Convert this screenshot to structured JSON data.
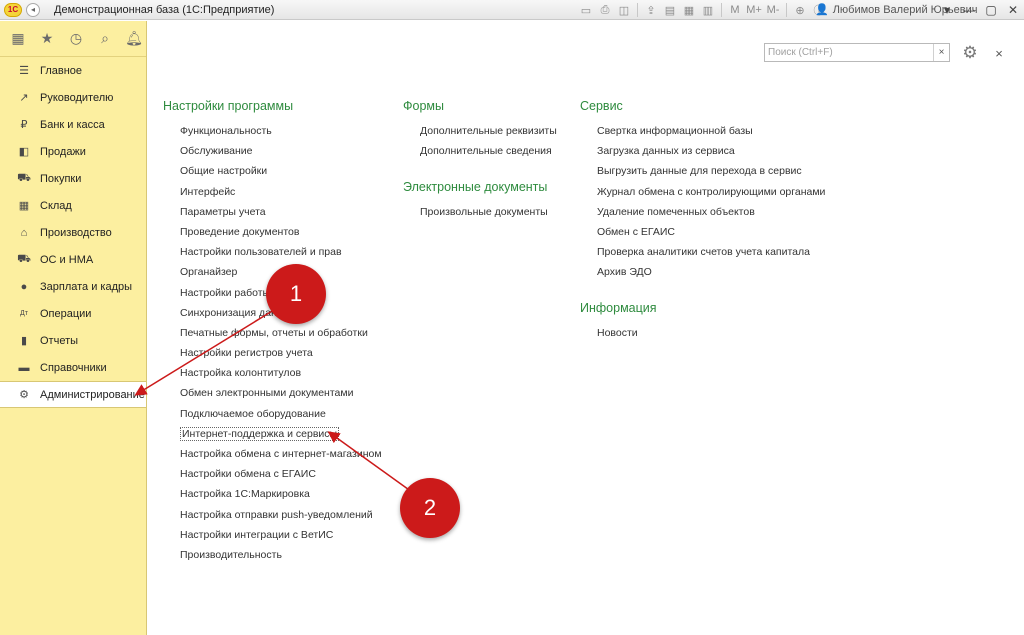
{
  "window": {
    "logo_text": "1С",
    "title": "Демонстрационная база  (1С:Предприятие)",
    "user": "Любимов Валерий Юрьевич",
    "toolbar_icons": [
      "save-icon",
      "print-icon",
      "preview-icon",
      "upload-icon",
      "doc-icon",
      "calc-icon",
      "calendar-icon",
      "M",
      "M+",
      "M-",
      "zoom-icon",
      "info-icon"
    ],
    "memory_labels": {
      "m": "M",
      "m_plus": "M+",
      "m_minus": "M-"
    }
  },
  "navbar": {
    "icons": [
      "apps-grid-icon",
      "star-icon",
      "history-icon",
      "search-icon",
      "bell-icon"
    ]
  },
  "sections": [
    {
      "label": "Главное",
      "icon": "menu-lines-icon"
    },
    {
      "label": "Руководителю",
      "icon": "trend-chart-icon"
    },
    {
      "label": "Банк и касса",
      "icon": "ruble-coin-icon"
    },
    {
      "label": "Продажи",
      "icon": "shopping-bag-icon"
    },
    {
      "label": "Покупки",
      "icon": "cart-icon"
    },
    {
      "label": "Склад",
      "icon": "warehouse-grid-icon"
    },
    {
      "label": "Производство",
      "icon": "factory-icon"
    },
    {
      "label": "ОС и НМА",
      "icon": "truck-icon"
    },
    {
      "label": "Зарплата и кадры",
      "icon": "person-icon"
    },
    {
      "label": "Операции",
      "icon": "dt-kt-icon"
    },
    {
      "label": "Отчеты",
      "icon": "bar-chart-icon"
    },
    {
      "label": "Справочники",
      "icon": "book-icon"
    },
    {
      "label": "Администрирование",
      "icon": "gear-icon",
      "active": true
    }
  ],
  "search": {
    "placeholder": "Поиск (Ctrl+F)",
    "clear": "×"
  },
  "close_symbol": "×",
  "groups": {
    "settings": {
      "title": "Настройки программы",
      "items": [
        "Функциональность",
        "Обслуживание",
        "Общие настройки",
        "Интерфейс",
        "Параметры учета",
        "Проведение документов",
        "Настройки пользователей и прав",
        "Органайзер",
        "Настройки работы",
        "Синхронизация данных",
        "Печатные формы, отчеты и обработки",
        "Настройки регистров учета",
        "Настройка колонтитулов",
        "Обмен электронными документами",
        "Подключаемое оборудование",
        "Интернет-поддержка и сервисы",
        "Настройка обмена с интернет-магазином",
        "Настройки обмена с ЕГАИС",
        "Настройка 1С:Маркировка",
        "Настройка отправки push-уведомлений",
        "Настройки интеграции с ВетИС",
        "Производительность"
      ]
    },
    "forms": {
      "title": "Формы",
      "items": [
        "Дополнительные реквизиты",
        "Дополнительные сведения"
      ]
    },
    "edocs": {
      "title": "Электронные документы",
      "items": [
        "Произвольные документы"
      ]
    },
    "service": {
      "title": "Сервис",
      "items": [
        "Свертка информационной базы",
        "Загрузка данных из сервиса",
        "Выгрузить данные для перехода в сервис",
        "Журнал обмена с контролирующими органами",
        "Удаление помеченных объектов",
        "Обмен с ЕГАИС",
        "Проверка аналитики счетов учета капитала",
        "Архив ЭДО"
      ]
    },
    "info": {
      "title": "Информация",
      "items": [
        "Новости"
      ]
    }
  },
  "annotations": {
    "marker1": "1",
    "marker2": "2",
    "color": "#cc1a1a"
  },
  "colors": {
    "panel_bg": "#fcefa0",
    "group_title": "#2e8b3e"
  }
}
